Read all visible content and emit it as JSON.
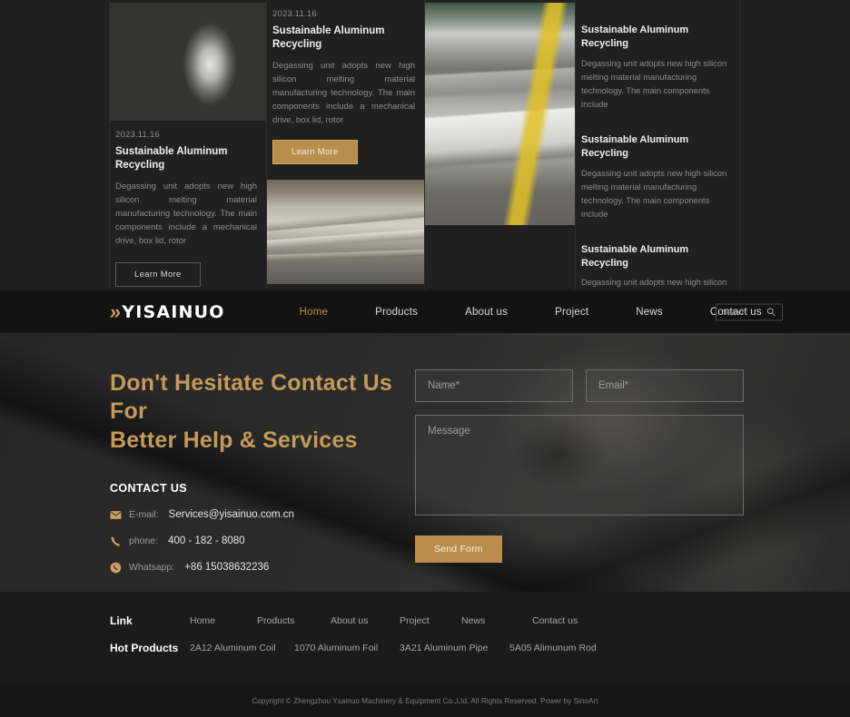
{
  "news": {
    "featured_left": {
      "date": "2023.11.16",
      "title": "Sustainable Aluminum Recycling",
      "desc": "Degassing unit adopts new high silicon melting material manufacturing technology. The main components include a mechanical drive, box lid, rotor",
      "button": "Learn More"
    },
    "featured_right": {
      "date": "2023.11.16",
      "title": "Sustainable Aluminum Recycling",
      "desc": "Degassing unit adopts new high silicon melting material manufacturing technology. The main components include a mechanical drive, box lid, rotor",
      "button": "Learn More"
    },
    "list": [
      {
        "title": "Sustainable Aluminum Recycling",
        "desc": "Degassing unit adopts new high silicon melting material manufacturing technology. The main components include"
      },
      {
        "title": "Sustainable Aluminum Recycling",
        "desc": "Degassing unit adopts new high silicon melting material manufacturing technology. The main components include"
      },
      {
        "title": "Sustainable Aluminum Recycling",
        "desc": "Degassing unit adopts new high silicon melting material manufacturing technology. The main components include"
      }
    ]
  },
  "nav": {
    "logo": "YISAINUO",
    "logo_mark": "»",
    "items": [
      {
        "label": "Home",
        "active": true
      },
      {
        "label": "Products",
        "active": false
      },
      {
        "label": "About us",
        "active": false
      },
      {
        "label": "Project",
        "active": false
      },
      {
        "label": "News",
        "active": false
      },
      {
        "label": "Contact us",
        "active": false
      }
    ],
    "search_placeholder": "Search",
    "search_value": "",
    "search_icon": "search-icon"
  },
  "hero": {
    "heading_line1": "Don't Hesitate Contact Us For",
    "heading_line2": "Better Help & Services",
    "contact_title": "CONTACT US",
    "contacts": [
      {
        "icon": "envelope-icon",
        "key": "E-mail:",
        "value": "Services@yisainuo.com.cn"
      },
      {
        "icon": "phone-icon",
        "key": "phone:",
        "value": "400 - 182 - 8080"
      },
      {
        "icon": "whatsapp-icon",
        "key": "Whatsapp:",
        "value": "+86 15038632236"
      }
    ],
    "form": {
      "name_placeholder": "Name*",
      "name_value": "",
      "email_placeholder": "Email*",
      "email_value": "",
      "message_placeholder": "Message",
      "message_value": "",
      "submit_label": "Send Form"
    }
  },
  "footer": {
    "link_label": "Link",
    "links": [
      "Home",
      "Products",
      "About us",
      "Project",
      "News",
      "Contact us"
    ],
    "hot_label": "Hot Products",
    "hot_products": [
      "2A12 Aluminum Coil",
      "1070 Aluminum Foil",
      "3A21 Aluminum Pipe",
      "5A05 Alimunum Rod"
    ],
    "copyright": "Copyright © Zhengzhou Ysainuo Machinery & Equipment Co.,Ltd. All Rights Reserved. Power by SinoArt"
  },
  "colors": {
    "gold": "#b98e4d",
    "gold_text": "#c49a58",
    "dark_bg": "#202020",
    "nav_bg": "#131313",
    "footer_bg": "#1b1b1b"
  }
}
